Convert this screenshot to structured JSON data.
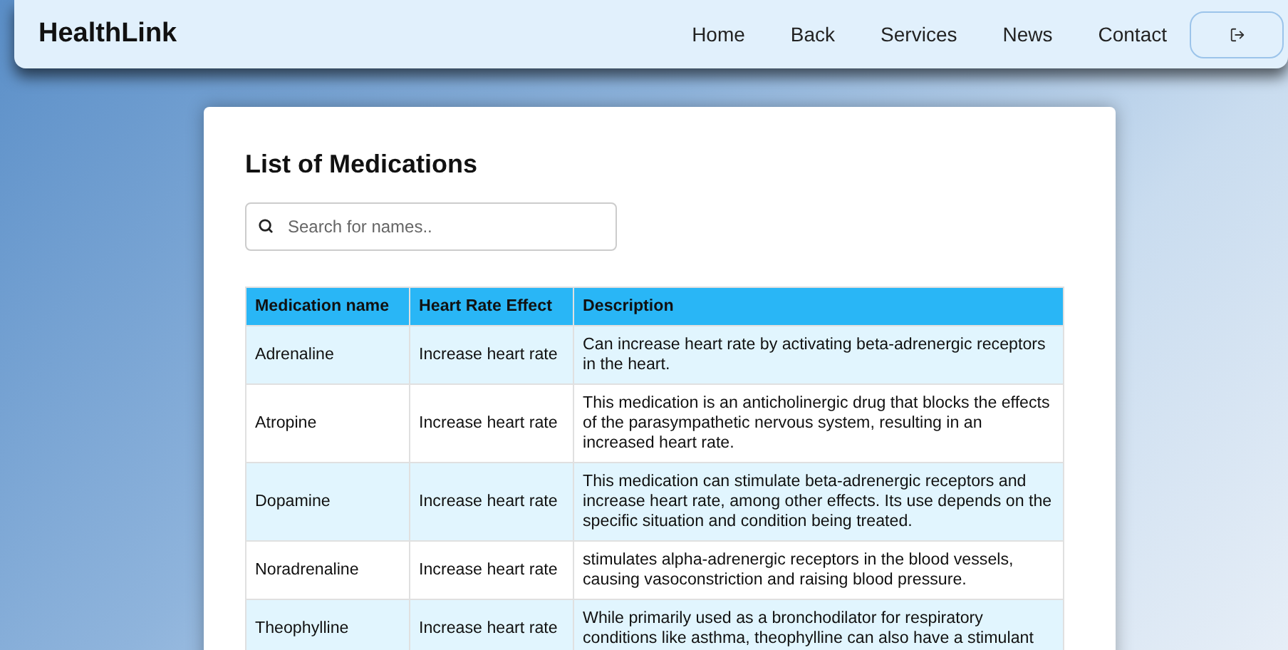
{
  "navbar": {
    "brand": "HealthLink",
    "links": [
      "Home",
      "Back",
      "Services",
      "News",
      "Contact"
    ]
  },
  "page": {
    "title": "List of Medications",
    "search": {
      "placeholder": "Search for names.."
    }
  },
  "table": {
    "columns": [
      "Medication name",
      "Heart Rate Effect",
      "Description"
    ],
    "rows": [
      [
        "Adrenaline",
        "Increase heart rate",
        "Can increase heart rate by activating beta-adrenergic receptors in the heart."
      ],
      [
        "Atropine",
        "Increase heart rate",
        "This medication is an anticholinergic drug that blocks the effects of the parasympathetic nervous system, resulting in an increased heart rate."
      ],
      [
        "Dopamine",
        "Increase heart rate",
        "This medication can stimulate beta-adrenergic receptors and increase heart rate, among other effects. Its use depends on the specific situation and condition being treated."
      ],
      [
        "Noradrenaline",
        "Increase heart rate",
        "stimulates alpha-adrenergic receptors in the blood vessels, causing vasoconstriction and raising blood pressure."
      ],
      [
        "Theophylline",
        "Increase heart rate",
        "While primarily used as a bronchodilator for respiratory conditions like asthma, theophylline can also have a stimulant"
      ]
    ]
  }
}
